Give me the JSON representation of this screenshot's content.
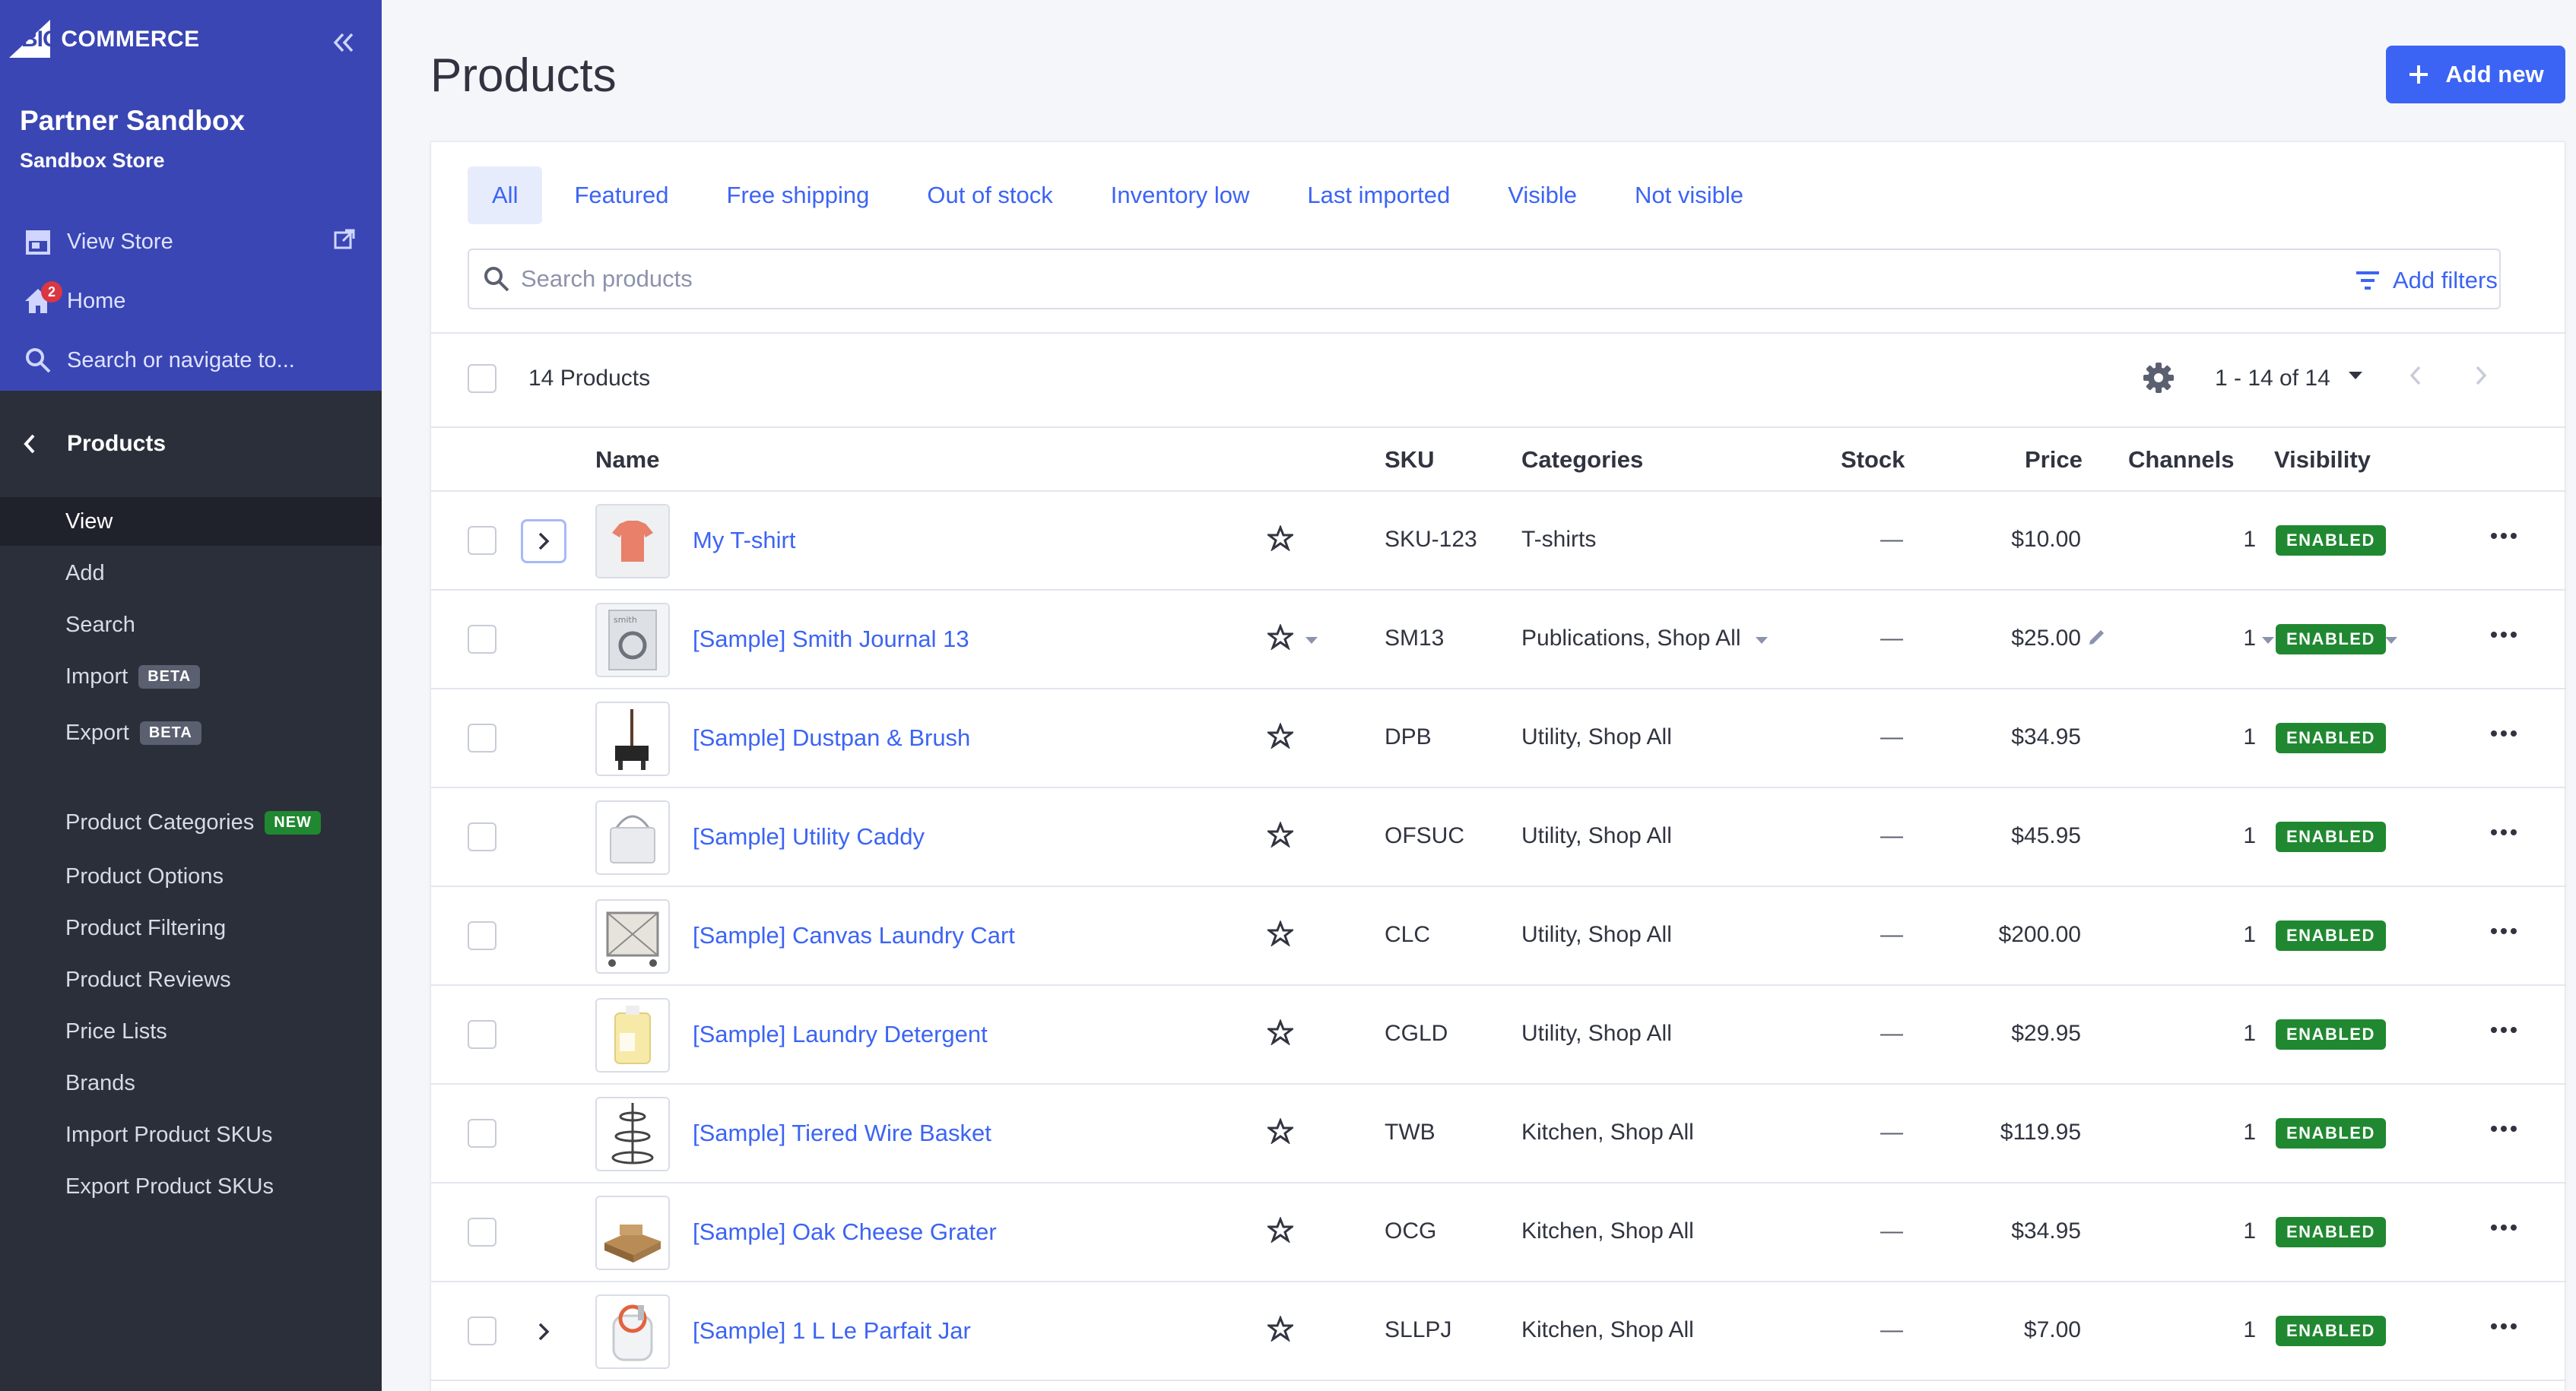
{
  "sidebar": {
    "logo_big": "BIG",
    "logo_commerce": "COMMERCE",
    "store_name": "Partner Sandbox",
    "store_sub": "Sandbox Store",
    "view_store": "View Store",
    "home": "Home",
    "home_badge": "2",
    "search_nav": "Search or navigate to...",
    "section": "Products",
    "items": [
      {
        "label": "View"
      },
      {
        "label": "Add"
      },
      {
        "label": "Search"
      },
      {
        "label": "Import",
        "tag": "BETA"
      },
      {
        "label": "Export",
        "tag": "BETA"
      },
      {
        "label": "Product Categories",
        "tag": "NEW"
      },
      {
        "label": "Product Options"
      },
      {
        "label": "Product Filtering"
      },
      {
        "label": "Product Reviews"
      },
      {
        "label": "Price Lists"
      },
      {
        "label": "Brands"
      },
      {
        "label": "Import Product SKUs"
      },
      {
        "label": "Export Product SKUs"
      }
    ]
  },
  "header": {
    "title": "Products",
    "add_new": "Add new"
  },
  "tabs": [
    "All",
    "Featured",
    "Free shipping",
    "Out of stock",
    "Inventory low",
    "Last imported",
    "Visible",
    "Not visible"
  ],
  "search": {
    "placeholder": "Search products",
    "add_filters": "Add filters"
  },
  "toolbar": {
    "count": "14 Products",
    "pagination": "1 - 14 of 14"
  },
  "columns": {
    "name": "Name",
    "sku": "SKU",
    "categories": "Categories",
    "stock": "Stock",
    "price": "Price",
    "channels": "Channels",
    "visibility": "Visibility"
  },
  "rows": [
    {
      "name": "My T-shirt",
      "sku": "SKU-123",
      "categories": "T-shirts",
      "stock": "—",
      "price": "$10.00",
      "channels": "1",
      "visibility": "ENABLED"
    },
    {
      "name": "[Sample] Smith Journal 13",
      "sku": "SM13",
      "categories": "Publications, Shop All",
      "stock": "—",
      "price": "$25.00",
      "channels": "1",
      "visibility": "ENABLED"
    },
    {
      "name": "[Sample] Dustpan & Brush",
      "sku": "DPB",
      "categories": "Utility, Shop All",
      "stock": "—",
      "price": "$34.95",
      "channels": "1",
      "visibility": "ENABLED"
    },
    {
      "name": "[Sample] Utility Caddy",
      "sku": "OFSUC",
      "categories": "Utility, Shop All",
      "stock": "—",
      "price": "$45.95",
      "channels": "1",
      "visibility": "ENABLED"
    },
    {
      "name": "[Sample] Canvas Laundry Cart",
      "sku": "CLC",
      "categories": "Utility, Shop All",
      "stock": "—",
      "price": "$200.00",
      "channels": "1",
      "visibility": "ENABLED"
    },
    {
      "name": "[Sample] Laundry Detergent",
      "sku": "CGLD",
      "categories": "Utility, Shop All",
      "stock": "—",
      "price": "$29.95",
      "channels": "1",
      "visibility": "ENABLED"
    },
    {
      "name": "[Sample] Tiered Wire Basket",
      "sku": "TWB",
      "categories": "Kitchen, Shop All",
      "stock": "—",
      "price": "$119.95",
      "channels": "1",
      "visibility": "ENABLED"
    },
    {
      "name": "[Sample] Oak Cheese Grater",
      "sku": "OCG",
      "categories": "Kitchen, Shop All",
      "stock": "—",
      "price": "$34.95",
      "channels": "1",
      "visibility": "ENABLED"
    },
    {
      "name": "[Sample] 1 L Le Parfait Jar",
      "sku": "SLLPJ",
      "categories": "Kitchen, Shop All",
      "stock": "—",
      "price": "$7.00",
      "channels": "1",
      "visibility": "ENABLED"
    }
  ],
  "colors": {
    "accent": "#3c64f4",
    "sidebar_top": "#3a46b4",
    "sidebar": "#2b2f3a",
    "enabled": "#208831"
  }
}
